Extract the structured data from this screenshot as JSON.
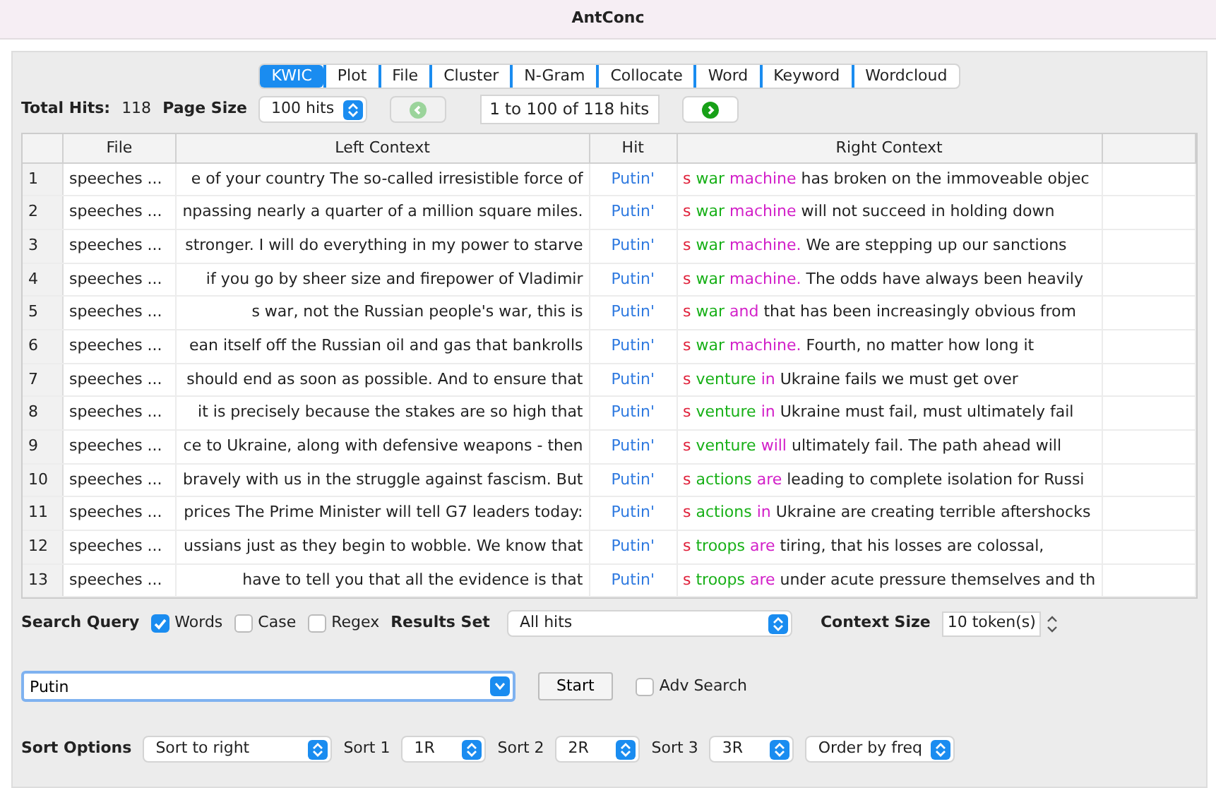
{
  "window": {
    "title": "AntConc"
  },
  "tabs": [
    {
      "label": "KWIC",
      "selected": true
    },
    {
      "label": "Plot",
      "selected": false
    },
    {
      "label": "File",
      "selected": false
    },
    {
      "label": "Cluster",
      "selected": false
    },
    {
      "label": "N-Gram",
      "selected": false
    },
    {
      "label": "Collocate",
      "selected": false
    },
    {
      "label": "Word",
      "selected": false
    },
    {
      "label": "Keyword",
      "selected": false
    },
    {
      "label": "Wordcloud",
      "selected": false
    }
  ],
  "toolbar": {
    "total_hits_label": "Total Hits:",
    "total_hits": "118",
    "page_size_label": "Page Size",
    "page_size": "100 hits",
    "prev_disabled": true,
    "next_disabled": false,
    "range": "1 to 100 of 118 hits"
  },
  "table": {
    "columns": [
      "File",
      "Left Context",
      "Hit",
      "Right Context"
    ],
    "rows": [
      {
        "n": "1",
        "file": "speeches ...",
        "left": "e of your country The so-called irresistible force of",
        "hit": "Putin'",
        "right": {
          "token": "s",
          "sort_1": "war",
          "sort_2": "machine",
          "rest": "has broken on the immoveable objec"
        }
      },
      {
        "n": "2",
        "file": "speeches ...",
        "left": "npassing nearly a quarter of a million square miles.",
        "hit": "Putin'",
        "right": {
          "token": "s",
          "sort_1": "war",
          "sort_2": "machine",
          "rest": "will not succeed in holding down"
        }
      },
      {
        "n": "3",
        "file": "speeches ...",
        "left": "stronger. I will do everything in my power to starve",
        "hit": "Putin'",
        "right": {
          "token": "s",
          "sort_1": "war",
          "sort_2": "machine.",
          "rest": "We are stepping up our sanctions"
        }
      },
      {
        "n": "4",
        "file": "speeches ...",
        "left": "if you go by sheer size and firepower of Vladimir",
        "hit": "Putin'",
        "right": {
          "token": "s",
          "sort_1": "war",
          "sort_2": "machine.",
          "rest": "The odds have always been heavily"
        }
      },
      {
        "n": "5",
        "file": "speeches ...",
        "left": "s war, not the Russian people's war, this is",
        "hit": "Putin'",
        "right": {
          "token": "s",
          "sort_1": "war",
          "sort_2": "and",
          "rest": "that has been increasingly obvious from"
        }
      },
      {
        "n": "6",
        "file": "speeches ...",
        "left": "ean itself off the Russian oil and gas that bankrolls",
        "hit": "Putin'",
        "right": {
          "token": "s",
          "sort_1": "war",
          "sort_2": "machine.",
          "rest": "Fourth, no matter how long it"
        }
      },
      {
        "n": "7",
        "file": "speeches ...",
        "left": "should end as soon as possible. And to ensure that",
        "hit": "Putin'",
        "right": {
          "token": "s",
          "sort_1": "venture",
          "sort_2": "in",
          "rest": "Ukraine fails we must get over"
        }
      },
      {
        "n": "8",
        "file": "speeches ...",
        "left": "it is precisely because the stakes are so high that",
        "hit": "Putin'",
        "right": {
          "token": "s",
          "sort_1": "venture",
          "sort_2": "in",
          "rest": "Ukraine must fail, must ultimately fail"
        }
      },
      {
        "n": "9",
        "file": "speeches ...",
        "left": "ce to Ukraine, along with defensive weapons - then",
        "hit": "Putin'",
        "right": {
          "token": "s",
          "sort_1": "venture",
          "sort_2": "will",
          "rest": "ultimately fail. The path ahead will"
        }
      },
      {
        "n": "10",
        "file": "speeches ...",
        "left": "bravely with us in the struggle against fascism. But",
        "hit": "Putin'",
        "right": {
          "token": "s",
          "sort_1": "actions",
          "sort_2": "are",
          "rest": "leading to complete isolation for Russi"
        }
      },
      {
        "n": "11",
        "file": "speeches ...",
        "left": "prices The Prime Minister will tell G7 leaders today:",
        "hit": "Putin'",
        "right": {
          "token": "s",
          "sort_1": "actions",
          "sort_2": "in",
          "rest": "Ukraine are creating terrible aftershocks"
        }
      },
      {
        "n": "12",
        "file": "speeches ...",
        "left": "ussians just as they begin to wobble. We know that",
        "hit": "Putin'",
        "right": {
          "token": "s",
          "sort_1": "troops",
          "sort_2": "are",
          "rest": "tiring, that his losses are colossal,"
        }
      },
      {
        "n": "13",
        "file": "speeches ...",
        "left": "have to tell you that all the evidence is that",
        "hit": "Putin'",
        "right": {
          "token": "s",
          "sort_1": "troops",
          "sort_2": "are",
          "rest": "under acute pressure themselves and th"
        }
      }
    ]
  },
  "search": {
    "label": "Search Query",
    "options": [
      {
        "label": "Words",
        "checked": true
      },
      {
        "label": "Case",
        "checked": false
      },
      {
        "label": "Regex",
        "checked": false
      }
    ],
    "results_set_label": "Results Set",
    "results_set": "All hits",
    "context_size_label": "Context Size",
    "context_size": "10 token(s)",
    "query": "Putin",
    "start": "Start",
    "adv_search": {
      "label": "Adv Search",
      "checked": false
    }
  },
  "sort": {
    "label": "Sort Options",
    "mode": "Sort to right",
    "levels": [
      {
        "label": "Sort 1",
        "value": "1R"
      },
      {
        "label": "Sort 2",
        "value": "2R"
      },
      {
        "label": "Sort 3",
        "value": "3R"
      }
    ],
    "order": "Order by freq"
  }
}
